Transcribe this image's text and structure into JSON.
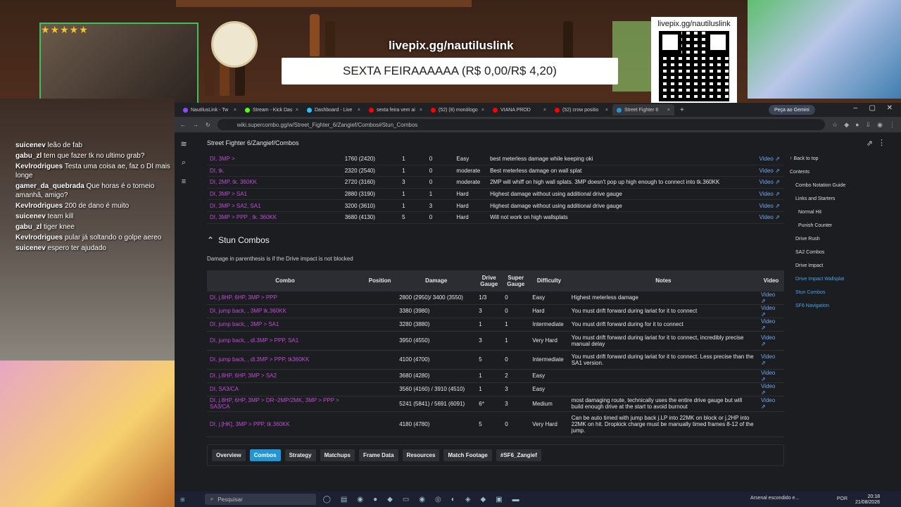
{
  "overlay": {
    "url": "livepix.gg/nautiluslink",
    "goal": "SEXTA FEIRAAAAAA (R$ 0,00/R$ 4,20)",
    "qr_label": "livepix.gg/nautiluslink",
    "stars": "★★★★★"
  },
  "chat": [
    {
      "user": "suicenev",
      "text": "leão de fab"
    },
    {
      "user": "gabu_zl",
      "text": "tem que fazer tk no ultimo grab?"
    },
    {
      "user": "Kevlrodrigues",
      "text": "Testa uma coisa ae, faz o DI mais longe"
    },
    {
      "user": "gamer_da_quebrada",
      "text": "Que horas é o torneio amanhã, amigo?"
    },
    {
      "user": "Kevlrodrigues",
      "text": "200 de dano é muito"
    },
    {
      "user": "suicenev",
      "text": "team kill"
    },
    {
      "user": "gabu_zl",
      "text": "tiger knee"
    },
    {
      "user": "Kevlrodrigues",
      "text": "pular já soltando o golpe aereo"
    },
    {
      "user": "suicenev",
      "text": "espero ter ajudado"
    }
  ],
  "browser": {
    "tabs": [
      "NautilusLink - Tw",
      "Stream - Kick Das",
      "Dashboard - Live",
      "sexta feira vem ai",
      "(52) (8) monólogo",
      "VIANA PROD",
      "(52) crow positio",
      "Street Fighter 6"
    ],
    "gemini": "Peça ao Gemini",
    "url": "wiki.supercombo.gg/w/Street_Fighter_6/Zangief/Combos#Stun_Combos",
    "breadcrumb": "Street Fighter 6/Zangief/Combos"
  },
  "table1": {
    "rows": [
      {
        "combo": "DI, 3MP >",
        "damage": "1760 (2420)",
        "drive": "1",
        "super": "0",
        "difficulty": "Easy",
        "notes": "best meterless damage while keeping oki",
        "video": "Video ⇗"
      },
      {
        "combo": "DI, tk.",
        "damage": "2320 (2540)",
        "drive": "1",
        "super": "0",
        "difficulty": "moderate",
        "notes": "Best meterless damage on wall splat",
        "video": "Video ⇗"
      },
      {
        "combo": "DI, 2MP, tk. 360KK",
        "damage": "2720 (3160)",
        "drive": "3",
        "super": "0",
        "difficulty": "moderate",
        "notes": "2MP will whiff on high wall splats. 3MP doesn't pop up high enough to connect into tk.360KK",
        "video": "Video ⇗"
      },
      {
        "combo": "DI, 3MP > SA1",
        "damage": "2880 (3190)",
        "drive": "1",
        "super": "1",
        "difficulty": "Hard",
        "notes": "Highest damage without using additional drive gauge",
        "video": "Video ⇗"
      },
      {
        "combo": "DI, 3MP > SA2, SA1",
        "damage": "3200 (3610)",
        "drive": "1",
        "super": "3",
        "difficulty": "Hard",
        "notes": "Highest damage without using additional drive gauge",
        "video": "Video ⇗"
      },
      {
        "combo": "DI, 3MP > PPP , tk. 360KK",
        "damage": "3680 (4130)",
        "drive": "5",
        "super": "0",
        "difficulty": "Hard",
        "notes": "Will not work on high wallsplats",
        "video": "Video ⇗"
      }
    ]
  },
  "section": {
    "title": "Stun Combos",
    "subtitle": "Damage in parenthesis is if the Drive impact is not blocked"
  },
  "table2": {
    "headers": [
      "Combo",
      "Position",
      "Damage",
      "Drive Gauge",
      "Super Gauge",
      "Difficulty",
      "Notes",
      "Video"
    ],
    "rows": [
      {
        "combo": "DI, j.8HP, 6HP, 3MP > PPP",
        "position": "",
        "damage": "2800 (2950)/ 3400 (3550)",
        "drive": "1/3",
        "super": "0",
        "difficulty": "Easy",
        "notes": "Highest meterless damage",
        "video": "Video ⇗"
      },
      {
        "combo": "DI, jump back, , 3MP tk.360KK",
        "position": "",
        "damage": "3380 (3980)",
        "drive": "3",
        "super": "0",
        "difficulty": "Hard",
        "notes": "You must drift forward during lariat for it to connect",
        "video": "Video ⇗"
      },
      {
        "combo": "DI, jump back, , 3MP > SA1",
        "position": "",
        "damage": "3280 (3880)",
        "drive": "1",
        "super": "1",
        "difficulty": "Intermediate",
        "notes": "You must drift forward during for it to connect",
        "video": "Video ⇗"
      },
      {
        "combo": "DI, jump back, , dl.3MP > PPP, SA1",
        "position": "",
        "damage": "3950 (4550)",
        "drive": "3",
        "super": "1",
        "difficulty": "Very Hard",
        "notes": "You must drift forward during lariat for it to connect, incredibly precise manual delay",
        "video": "Video ⇗"
      },
      {
        "combo": "DI, jump back, , dl.3MP > PPP, tk360KK",
        "position": "",
        "damage": "4100 (4700)",
        "drive": "5",
        "super": "0",
        "difficulty": "Intermediate",
        "notes": "You must drift forward during lariat for it to connect. Less precise than the SA1 version.",
        "video": "Video ⇗"
      },
      {
        "combo": "DI, j.8HP, 6HP, 3MP > SA2",
        "position": "",
        "damage": "3680 (4280)",
        "drive": "1",
        "super": "2",
        "difficulty": "Easy",
        "notes": "",
        "video": "Video ⇗"
      },
      {
        "combo": "DI, SA3/CA",
        "position": "",
        "damage": "3560 (4160) / 3910 (4510)",
        "drive": "1",
        "super": "3",
        "difficulty": "Easy",
        "notes": "",
        "video": "Video ⇗"
      },
      {
        "combo": "DI, j.8HP, 6HP, 3MP > DR~2MP/2MK, 3MP > PPP > SA3/CA",
        "position": "",
        "damage": "5241 (5841) / 5691 (6091)",
        "drive": "6*",
        "super": "3",
        "difficulty": "Medium",
        "notes": "most damaging route, technically uses the entire drive gauge but will build enough drive at the start to avoid burnout",
        "video": "Video ⇗"
      },
      {
        "combo": "DI, j.[HK], 3MP > PPP, tk.360KK",
        "position": "",
        "damage": "4180 (4780)",
        "drive": "5",
        "super": "0",
        "difficulty": "Very Hard",
        "notes": "Can be auto timed with jump back j.LP into 22MK on block or j.2HP into 22MK on hit. Dropkick charge must be manually timed frames 8-12 of the jump.",
        "video": ""
      }
    ]
  },
  "nav_buttons": [
    "Overview",
    "Combos",
    "Strategy",
    "Matchups",
    "Frame Data",
    "Resources",
    "Match Footage",
    "#SF6_Zangief"
  ],
  "toc": {
    "back": "Back to top",
    "contents": "Contents",
    "items": [
      "Combo Notation Guide",
      "Links and Starters",
      "Normal Hit",
      "Punish Counter",
      "Drive Rush",
      "SA2 Combos",
      "Drive Impact",
      "Drive Impact Wallsplat",
      "Stun Combos",
      "SF6 Navigation"
    ]
  },
  "taskbar": {
    "search": "Pesquisar",
    "news": "Arsenal escondido e...",
    "lang": "POR",
    "time": "20:18",
    "date": "21/08/2026"
  }
}
